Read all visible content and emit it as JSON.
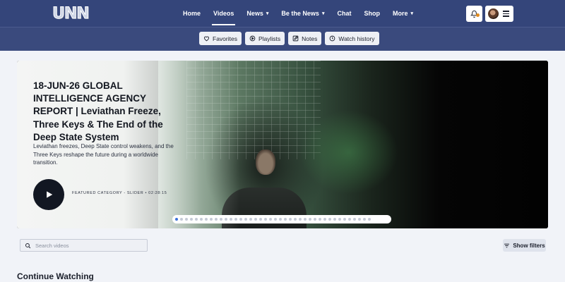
{
  "header": {
    "logo_text": "UNN",
    "nav": [
      {
        "label": "Home",
        "caret": ""
      },
      {
        "label": "Videos",
        "caret": ""
      },
      {
        "label": "News",
        "caret": "⌄"
      },
      {
        "label": "Be the News",
        "caret": "⌄"
      },
      {
        "label": "Chat",
        "caret": ""
      },
      {
        "label": "Shop",
        "caret": ""
      },
      {
        "label": "More",
        "caret": "⌄"
      }
    ],
    "active_nav": "Videos",
    "icons": {
      "notifications": "bell-icon",
      "menu": "hamburger-icon"
    }
  },
  "subnav": {
    "items": [
      {
        "label": "Favorites",
        "icon": "heart-icon"
      },
      {
        "label": "Playlists",
        "icon": "playlist-icon"
      },
      {
        "label": "Notes",
        "icon": "edit-icon"
      },
      {
        "label": "Watch history",
        "icon": "history-icon"
      }
    ]
  },
  "hero": {
    "title": "18-JUN-26 GLOBAL INTELLIGENCE AGENCY REPORT | Leviathan Freeze, Three Keys & The End of the Deep State System",
    "description": "Leviathan freezes, Deep State control weakens, and the Three Keys reshape the future during a worldwide transition.",
    "meta": "FEATURED CATEGORY - SLIDER • 02:28:15",
    "slide_count": 40,
    "active_slide": 1
  },
  "search": {
    "placeholder": "Search videos",
    "value": ""
  },
  "filters": {
    "label": "Show filters"
  },
  "sections": {
    "continue_watching": "Continue Watching"
  },
  "colors": {
    "nav_bg": "#34457a",
    "subnav_bg": "#3a4a7d",
    "accent": "#3b6fd8",
    "notification_dot": "#e08b1e"
  }
}
